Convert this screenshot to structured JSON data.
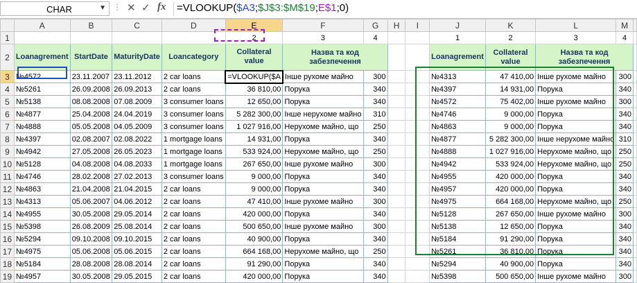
{
  "namebox": "CHAR",
  "formula": {
    "prefix": "=VLOOKUP(",
    "ref1": "$A3",
    "sep1": ";",
    "ref2": "$J$3:$M$19",
    "sep2": ";",
    "ref3": "E$1",
    "suffix": ";0)"
  },
  "columns": [
    "A",
    "B",
    "C",
    "D",
    "E",
    "F",
    "G",
    "H",
    "I",
    "J",
    "K",
    "L",
    "M"
  ],
  "row1": {
    "E": "2",
    "F": "3",
    "G": "4",
    "J": "1",
    "K": "2",
    "L": "3",
    "M": "4"
  },
  "headers_left": [
    "Loanagrement",
    "StartDate",
    "MaturityDate",
    "Loancategory",
    "Collateral value",
    "Назва та код забезпечення"
  ],
  "headers_right": [
    "Loanagrement",
    "Collateral value",
    "Назва та код забезпечення"
  ],
  "active_cell_text": "=VLOOKUP($A",
  "left_rows": [
    {
      "a": "№4572",
      "b": "23.11.2007",
      "c": "23.11.2012",
      "d": "2 car loans",
      "e": "",
      "f": "Інше рухоме майно",
      "g": "300"
    },
    {
      "a": "№5261",
      "b": "26.09.2008",
      "c": "26.09.2013",
      "d": "2 car loans",
      "e": "36 810,00",
      "f": "Порука",
      "g": "340"
    },
    {
      "a": "№5138",
      "b": "08.08.2008",
      "c": "07.08.2009",
      "d": "3 consumer loans",
      "e": "12 650,00",
      "f": "Порука",
      "g": "340"
    },
    {
      "a": "№4877",
      "b": "25.04.2008",
      "c": "24.04.2019",
      "d": "3 consumer loans",
      "e": "5 282 300,00",
      "f": "Інше нерухоме майно",
      "g": "310"
    },
    {
      "a": "№4888",
      "b": "05.05.2008",
      "c": "04.05.2009",
      "d": "3 consumer loans",
      "e": "1 027 916,00",
      "f": "Нерухоме майно, що",
      "g": "250"
    },
    {
      "a": "№4397",
      "b": "02.08.2007",
      "c": "02.08.2022",
      "d": "1 mortgage loans",
      "e": "14 931,00",
      "f": "Порука",
      "g": "340"
    },
    {
      "a": "№4942",
      "b": "27.05.2008",
      "c": "26.05.2023",
      "d": "1 mortgage loans",
      "e": "533 924,00",
      "f": "Нерухоме майно, що",
      "g": "250"
    },
    {
      "a": "№5128",
      "b": "04.08.2008",
      "c": "04.08.2033",
      "d": "1 mortgage loans",
      "e": "267 650,00",
      "f": "Інше рухоме майно",
      "g": "300"
    },
    {
      "a": "№4746",
      "b": "28.02.2008",
      "c": "27.02.2013",
      "d": "3 consumer loans",
      "e": "9 000,00",
      "f": "Порука",
      "g": "340"
    },
    {
      "a": "№4863",
      "b": "21.04.2008",
      "c": "21.04.2015",
      "d": "2 car loans",
      "e": "9 000,00",
      "f": "Порука",
      "g": "340"
    },
    {
      "a": "№4313",
      "b": "05.06.2007",
      "c": "04.06.2012",
      "d": "2 car loans",
      "e": "47 410,00",
      "f": "Інше рухоме майно",
      "g": "300"
    },
    {
      "a": "№4955",
      "b": "30.05.2008",
      "c": "29.05.2014",
      "d": "2 car loans",
      "e": "420 000,00",
      "f": "Порука",
      "g": "340"
    },
    {
      "a": "№5398",
      "b": "26.08.2009",
      "c": "25.08.2014",
      "d": "2 car loans",
      "e": "500 650,00",
      "f": "Інше рухоме майно",
      "g": "300"
    },
    {
      "a": "№5294",
      "b": "09.10.2008",
      "c": "09.10.2015",
      "d": "2 car loans",
      "e": "40 900,00",
      "f": "Порука",
      "g": "340"
    },
    {
      "a": "№4975",
      "b": "05.06.2008",
      "c": "05.06.2015",
      "d": "2 car loans",
      "e": "664 168,00",
      "f": "Нерухоме майно, що",
      "g": "250"
    },
    {
      "a": "№5184",
      "b": "28.08.2008",
      "c": "28.08.2014",
      "d": "2 car loans",
      "e": "91 290,00",
      "f": "Порука",
      "g": "340"
    },
    {
      "a": "№4957",
      "b": "30.05.2008",
      "c": "29.05.2015",
      "d": "2 car loans",
      "e": "420 000,00",
      "f": "Порука",
      "g": "340"
    }
  ],
  "right_rows": [
    {
      "j": "№4313",
      "k": "47 410,00",
      "l": "Інше рухоме майно",
      "m": "300"
    },
    {
      "j": "№4397",
      "k": "14 931,00",
      "l": "Порука",
      "m": "340"
    },
    {
      "j": "№4572",
      "k": "75 402,00",
      "l": "Інше рухоме майно",
      "m": "300"
    },
    {
      "j": "№4746",
      "k": "9 000,00",
      "l": "Порука",
      "m": "340"
    },
    {
      "j": "№4863",
      "k": "9 000,00",
      "l": "Порука",
      "m": "340"
    },
    {
      "j": "№4877",
      "k": "5 282 300,00",
      "l": "Інше нерухоме майно",
      "m": "310"
    },
    {
      "j": "№4888",
      "k": "1 027 916,00",
      "l": "Нерухоме майно, що",
      "m": "250"
    },
    {
      "j": "№4942",
      "k": "533 924,00",
      "l": "Нерухоме майно, що",
      "m": "250"
    },
    {
      "j": "№4955",
      "k": "420 000,00",
      "l": "Порука",
      "m": "340"
    },
    {
      "j": "№4957",
      "k": "420 000,00",
      "l": "Порука",
      "m": "340"
    },
    {
      "j": "№4975",
      "k": "664 168,00",
      "l": "Нерухоме майно, що",
      "m": "250"
    },
    {
      "j": "№5128",
      "k": "267 650,00",
      "l": "Інше рухоме майно",
      "m": "300"
    },
    {
      "j": "№5138",
      "k": "12 650,00",
      "l": "Порука",
      "m": "340"
    },
    {
      "j": "№5184",
      "k": "91 290,00",
      "l": "Порука",
      "m": "340"
    },
    {
      "j": "№5261",
      "k": "36 810,00",
      "l": "Порука",
      "m": "340"
    },
    {
      "j": "№5294",
      "k": "40 900,00",
      "l": "Порука",
      "m": "340"
    },
    {
      "j": "№5398",
      "k": "500 650,00",
      "l": "Інше рухоме майно",
      "m": "300"
    }
  ]
}
